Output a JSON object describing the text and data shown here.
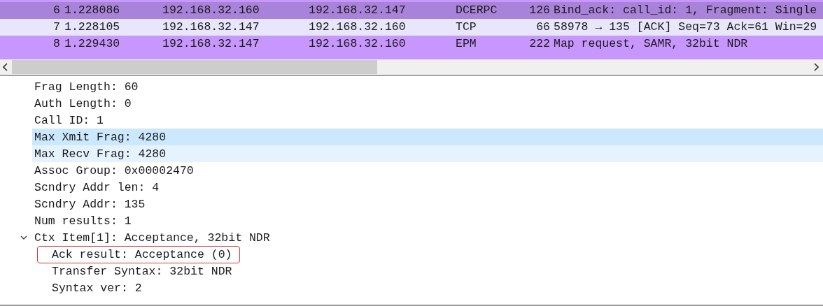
{
  "packets": [
    {
      "no": "6",
      "time": "1.228086",
      "source": "192.168.32.160",
      "destination": "192.168.32.147",
      "protocol": "DCERPC",
      "length": "126",
      "info": "Bind_ack: call_id: 1, Fragment: Single",
      "color": "#a983d9"
    },
    {
      "no": "7",
      "time": "1.228105",
      "source": "192.168.32.147",
      "destination": "192.168.32.160",
      "protocol": "TCP",
      "length": "66",
      "info": "58978 → 135 [ACK] Seq=73 Ack=61 Win=29",
      "color": "#e7e6fa"
    },
    {
      "no": "8",
      "time": "1.229430",
      "source": "192.168.32.147",
      "destination": "192.168.32.160",
      "protocol": "EPM",
      "length": "222",
      "info": "Map request, SAMR, 32bit NDR",
      "color": "#c797fd"
    }
  ],
  "details": [
    {
      "text": "Frag Length: 60",
      "selected": false,
      "hovered": false
    },
    {
      "text": "Auth Length: 0",
      "selected": false,
      "hovered": false
    },
    {
      "text": "Call ID: 1",
      "selected": false,
      "hovered": false
    },
    {
      "text": "Max Xmit Frag: 4280",
      "selected": true,
      "hovered": false
    },
    {
      "text": "Max Recv Frag: 4280",
      "selected": false,
      "hovered": true
    },
    {
      "text": "Assoc Group: 0x00002470",
      "selected": false,
      "hovered": false
    },
    {
      "text": "Scndry Addr len: 4",
      "selected": false,
      "hovered": false
    },
    {
      "text": "Scndry Addr: 135",
      "selected": false,
      "hovered": false
    },
    {
      "text": "Num results: 1",
      "selected": false,
      "hovered": false
    },
    {
      "text": "Ctx Item[1]: Acceptance, 32bit NDR",
      "selected": false,
      "hovered": false,
      "expanded": true,
      "children": [
        {
          "text": "Ack result: Acceptance (0)",
          "selected": false,
          "hovered": false,
          "outlined": true
        },
        {
          "text": "Transfer Syntax: 32bit NDR",
          "selected": false,
          "hovered": false,
          "outlined": false
        },
        {
          "text": "Syntax ver: 2",
          "selected": false,
          "hovered": false,
          "outlined": false
        }
      ]
    }
  ]
}
